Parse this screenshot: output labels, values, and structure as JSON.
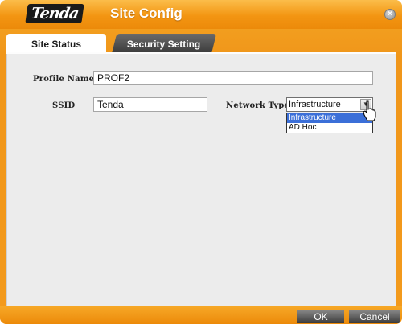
{
  "window": {
    "logo": "Tenda",
    "title": "Site Config"
  },
  "tabs": [
    {
      "label": "Site Status",
      "active": true
    },
    {
      "label": "Security Setting",
      "active": false
    }
  ],
  "form": {
    "profile_name_label": "Profile Name",
    "profile_name_value": "PROF2",
    "ssid_label": "SSID",
    "ssid_value": "Tenda",
    "network_type_label": "Network Type",
    "network_type_value": "Infrastructure",
    "network_type_options": [
      "Infrastructure",
      "AD Hoc"
    ]
  },
  "buttons": {
    "ok": "OK",
    "cancel": "Cancel"
  },
  "colors": {
    "brand_orange": "#f39512",
    "selection_blue": "#3b6fd8"
  }
}
